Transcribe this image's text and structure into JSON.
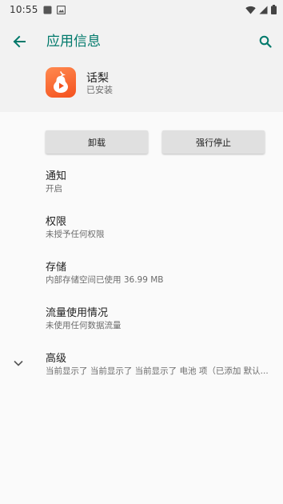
{
  "status_bar": {
    "time": "10:55"
  },
  "app_bar": {
    "title": "应用信息"
  },
  "app": {
    "name": "话梨",
    "status": "已安装"
  },
  "actions": {
    "uninstall_label": "卸载",
    "force_stop_label": "强行停止"
  },
  "prefs": [
    {
      "title": "通知",
      "summary": "开启"
    },
    {
      "title": "权限",
      "summary": "未授予任何权限"
    },
    {
      "title": "存储",
      "summary": "内部存储空间已使用 36.99 MB"
    },
    {
      "title": "流量使用情况",
      "summary": "未使用任何数据流量"
    },
    {
      "title": "高级",
      "summary": "当前显示了 当前显示了 当前显示了 电池 项（已添加 默认..."
    }
  ],
  "colors": {
    "accent": "#00796b",
    "app_icon": "#f4511e",
    "button_bg": "#e0e0e0"
  },
  "icons": {
    "back": "arrow-back-icon",
    "search": "search-icon",
    "expand": "chevron-down-icon"
  }
}
